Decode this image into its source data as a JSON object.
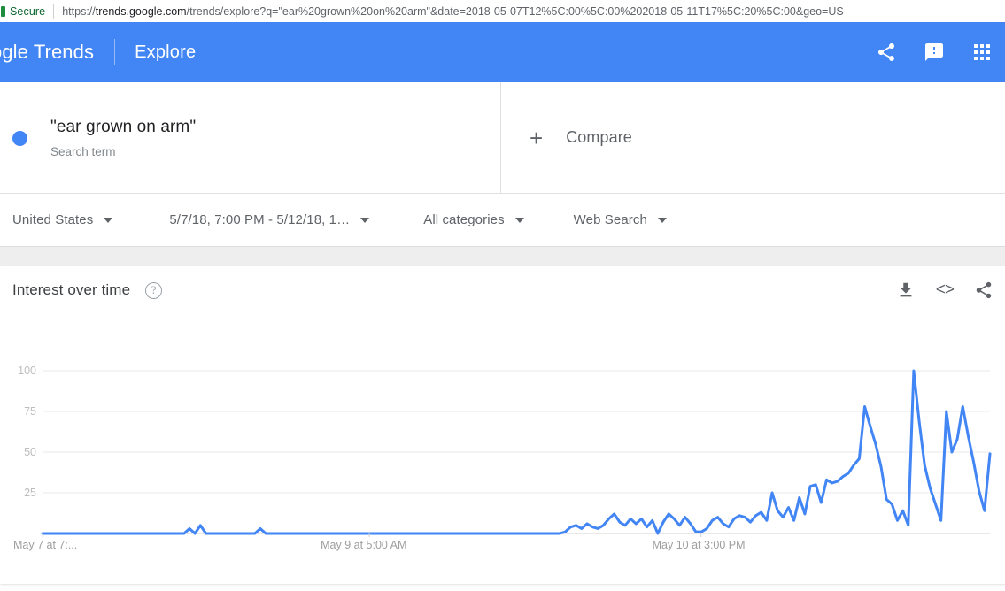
{
  "browser": {
    "security_label": "Secure",
    "url_scheme": "https://",
    "url_host": "trends.google.com",
    "url_path": "/trends/explore?q=\"ear%20grown%20on%20arm\"&date=2018-05-07T12%5C:00%5C:00%202018-05-11T17%5C:20%5C:00&geo=US"
  },
  "header": {
    "brand_visible": "ogle Trends",
    "brand_google_part": "ogle",
    "brand_trends_part": " Trends",
    "explore": "Explore",
    "icons": [
      "share-icon",
      "feedback-icon",
      "apps-grid-icon"
    ]
  },
  "terms": {
    "term_label": "\"ear grown on arm\"",
    "term_type": "Search term",
    "term_color": "#4285f4",
    "compare_plus": "+",
    "compare_label": "Compare"
  },
  "filters": {
    "geo": "United States",
    "date": "5/7/18, 7:00 PM - 5/12/18, 1…",
    "category": "All categories",
    "search_type": "Web Search"
  },
  "card": {
    "title": "Interest over time",
    "help": "?",
    "embed_label": "<>",
    "actions": [
      "download-icon",
      "embed-icon",
      "share-icon"
    ]
  },
  "chart_data": {
    "type": "line",
    "title": "Interest over time",
    "xlabel": "",
    "ylabel": "",
    "ylim": [
      0,
      100
    ],
    "yticks": [
      25,
      50,
      75,
      100
    ],
    "ytick_labels": [
      "25",
      "50",
      "75",
      "100"
    ],
    "grid": true,
    "legend": false,
    "line_color": "#4285f4",
    "line_width": 3,
    "xtick_labels": [
      "May 7 at 7:...",
      "May 9 at 5:00 AM",
      "May 10 at 3:00 PM"
    ],
    "xtick_positions": [
      0,
      0.345,
      0.695
    ],
    "series": [
      {
        "name": "\"ear grown on arm\"",
        "values": [
          0,
          0,
          0,
          0,
          0,
          0,
          0,
          0,
          0,
          0,
          0,
          0,
          0,
          0,
          0,
          0,
          0,
          0,
          0,
          0,
          0,
          0,
          0,
          0,
          0,
          0,
          0,
          3,
          0,
          5,
          0,
          0,
          0,
          0,
          0,
          0,
          0,
          0,
          0,
          0,
          3,
          0,
          0,
          0,
          0,
          0,
          0,
          0,
          0,
          0,
          0,
          0,
          0,
          0,
          0,
          0,
          0,
          0,
          0,
          0,
          0,
          0,
          0,
          0,
          0,
          0,
          0,
          0,
          0,
          0,
          0,
          0,
          0,
          0,
          0,
          0,
          0,
          0,
          0,
          0,
          0,
          0,
          0,
          0,
          0,
          0,
          0,
          0,
          0,
          0,
          0,
          0,
          0,
          0,
          0,
          0,
          1,
          4,
          5,
          3,
          6,
          4,
          3,
          5,
          9,
          12,
          7,
          5,
          9,
          6,
          9,
          4,
          8,
          0,
          7,
          12,
          9,
          5,
          10,
          6,
          1,
          1,
          3,
          8,
          10,
          6,
          4,
          9,
          11,
          10,
          7,
          11,
          13,
          8,
          25,
          14,
          10,
          16,
          8,
          22,
          12,
          29,
          30,
          19,
          33,
          31,
          32,
          35,
          37,
          42,
          46,
          78,
          66,
          55,
          41,
          21,
          18,
          8,
          14,
          5,
          100,
          69,
          42,
          28,
          18,
          8,
          75,
          50,
          58,
          78,
          60,
          44,
          26,
          14,
          49
        ]
      }
    ]
  }
}
